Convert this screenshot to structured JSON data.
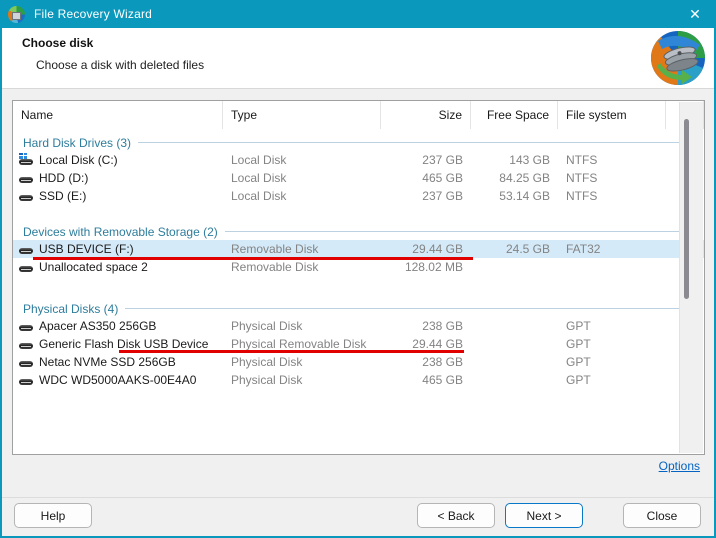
{
  "window": {
    "title": "File Recovery Wizard",
    "close_glyph": "✕"
  },
  "header": {
    "title": "Choose disk",
    "subtitle": "Choose a disk with deleted files"
  },
  "table": {
    "columns": [
      "Name",
      "Type",
      "Size",
      "Free Space",
      "File system"
    ],
    "groups": [
      {
        "label": "Hard Disk Drives (3)",
        "rows": [
          {
            "name": "Local Disk (C:)",
            "type": "Local Disk",
            "size": "237 GB",
            "free": "143 GB",
            "fs": "NTFS",
            "icon": "windows-disk-icon"
          },
          {
            "name": "HDD (D:)",
            "type": "Local Disk",
            "size": "465 GB",
            "free": "84.25 GB",
            "fs": "NTFS",
            "icon": "disk-icon"
          },
          {
            "name": "SSD (E:)",
            "type": "Local Disk",
            "size": "237 GB",
            "free": "53.14 GB",
            "fs": "NTFS",
            "icon": "disk-icon"
          }
        ]
      },
      {
        "label": "Devices with Removable Storage (2)",
        "rows": [
          {
            "name": "USB DEVICE (F:)",
            "type": "Removable Disk",
            "size": "29.44 GB",
            "free": "24.5 GB",
            "fs": "FAT32",
            "icon": "disk-icon",
            "selected": true,
            "annotated": true
          },
          {
            "name": "Unallocated space 2",
            "type": "Removable Disk",
            "size": "128.02 MB",
            "free": "",
            "fs": "",
            "icon": "disk-icon"
          }
        ]
      },
      {
        "label": "Physical Disks (4)",
        "rows": [
          {
            "name": "Apacer AS350 256GB",
            "type": "Physical Disk",
            "size": "238 GB",
            "free": "",
            "fs": "GPT",
            "icon": "disk-icon"
          },
          {
            "name": "Generic Flash Disk USB Device",
            "type": "Physical Removable Disk",
            "size": "29.44 GB",
            "free": "",
            "fs": "GPT",
            "icon": "disk-icon",
            "annotated": true
          },
          {
            "name": "Netac NVMe SSD 256GB",
            "type": "Physical Disk",
            "size": "238 GB",
            "free": "",
            "fs": "GPT",
            "icon": "disk-icon"
          },
          {
            "name": "WDC WD5000AAKS-00E4A0",
            "type": "Physical Disk",
            "size": "465 GB",
            "free": "",
            "fs": "GPT",
            "icon": "disk-icon"
          }
        ]
      }
    ]
  },
  "footer": {
    "options_label": "Options",
    "help_label": "Help",
    "back_label": "< Back",
    "next_label": "Next >",
    "close_label": "Close"
  },
  "colors": {
    "accent_teal": "#0a99bd",
    "group_heading": "#2e7d9c",
    "selection_blue": "#d5eaf8",
    "annotation_red": "#e00000",
    "link_blue": "#0563c1",
    "default_button_border": "#0a78c8"
  }
}
